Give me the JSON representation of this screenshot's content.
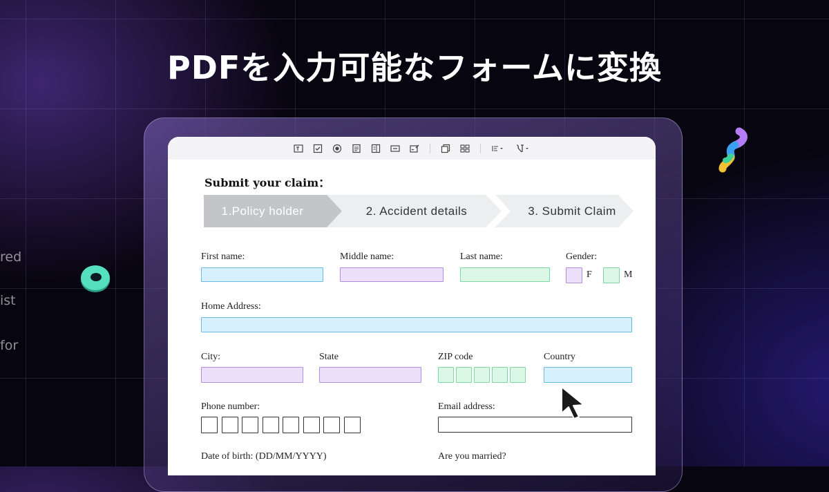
{
  "headline": "PDFを入力可能なフォームに変換",
  "side_texts": [
    "red",
    "ist",
    "for"
  ],
  "toolbar": {
    "icons": [
      "text-field-icon",
      "checkbox-icon",
      "radio-button-icon",
      "list-box-icon",
      "dropdown-icon",
      "button-field-icon",
      "signature-icon",
      "duplicate-icon",
      "grid-icon",
      "align-icon",
      "tools-icon"
    ]
  },
  "form": {
    "title": "Submit your claim：",
    "steps": [
      "1.Policy holder",
      "2. Accident details",
      "3. Submit Claim"
    ],
    "labels": {
      "first_name": "First name:",
      "middle_name": "Middle name:",
      "last_name": "Last name:",
      "gender": "Gender:",
      "gender_f": "F",
      "gender_m": "M",
      "home_address": "Home Address:",
      "city": "City:",
      "state": "State",
      "zip": "ZIP code",
      "country": "Country",
      "phone": "Phone number:",
      "email": "Email address:",
      "dob": "Date of birth: (DD/MM/YYYY)",
      "married": "Are you married?"
    }
  },
  "colors": {
    "accent_blue": "#67b9e8",
    "accent_purple": "#b18de6",
    "accent_green": "#7fd8a4"
  }
}
